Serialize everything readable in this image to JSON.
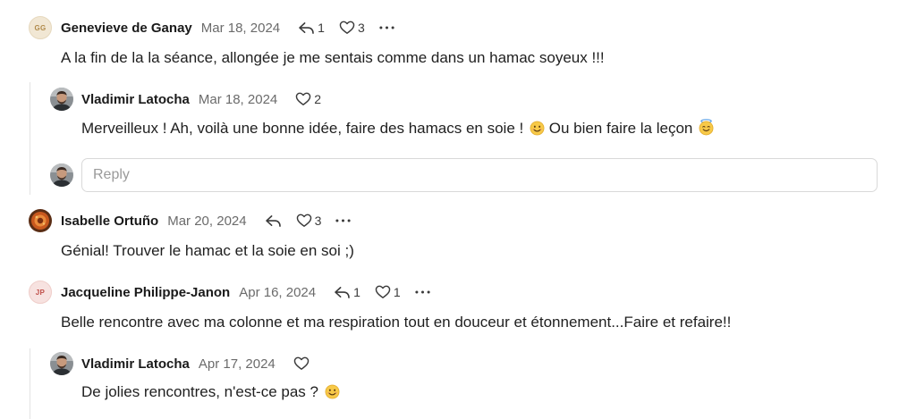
{
  "comments": [
    {
      "author": "Genevieve de Ganay",
      "initials": "GG",
      "date": "Mar 18, 2024",
      "reply_count": "1",
      "like_count": "3",
      "text": "A la fin de la la séance, allongée je me sentais comme dans un hamac soyeux !!!",
      "replies": [
        {
          "author": "Vladimir Latocha",
          "date": "Mar 18, 2024",
          "like_count": "2",
          "text": "Merveilleux ! Ah, voilà une bonne idée, faire des hamacs en soie !",
          "text_tail": "Ou bien faire la leçon"
        }
      ],
      "reply_placeholder": "Reply"
    },
    {
      "author": "Isabelle Ortuño",
      "date": "Mar 20, 2024",
      "like_count": "3",
      "text": "Génial! Trouver le hamac et la soie en soi ;)"
    },
    {
      "author": "Jacqueline Philippe-Janon",
      "initials": "JP",
      "date": "Apr 16, 2024",
      "reply_count": "1",
      "like_count": "1",
      "text": "Belle rencontre avec ma colonne et ma respiration tout en douceur et étonnement...Faire et refaire!!",
      "replies": [
        {
          "author": "Vladimir Latocha",
          "date": "Apr 17, 2024",
          "text": "De jolies rencontres, n'est-ce pas ?"
        }
      ]
    }
  ],
  "icons": {
    "reply": "reply-arrow-icon",
    "like": "heart-icon",
    "more": "more-dots-icon",
    "smile": "smiling-face-emoji",
    "halo": "smiling-face-with-halo-emoji"
  },
  "colors": {
    "gg_avatar_bg": "#f1e7d4",
    "gg_avatar_text": "#b08a4a",
    "jp_avatar_bg": "#f7e2e0",
    "jp_avatar_text": "#c0504a",
    "date": "#6b6b6b",
    "thread_line": "#e3e3e3"
  }
}
